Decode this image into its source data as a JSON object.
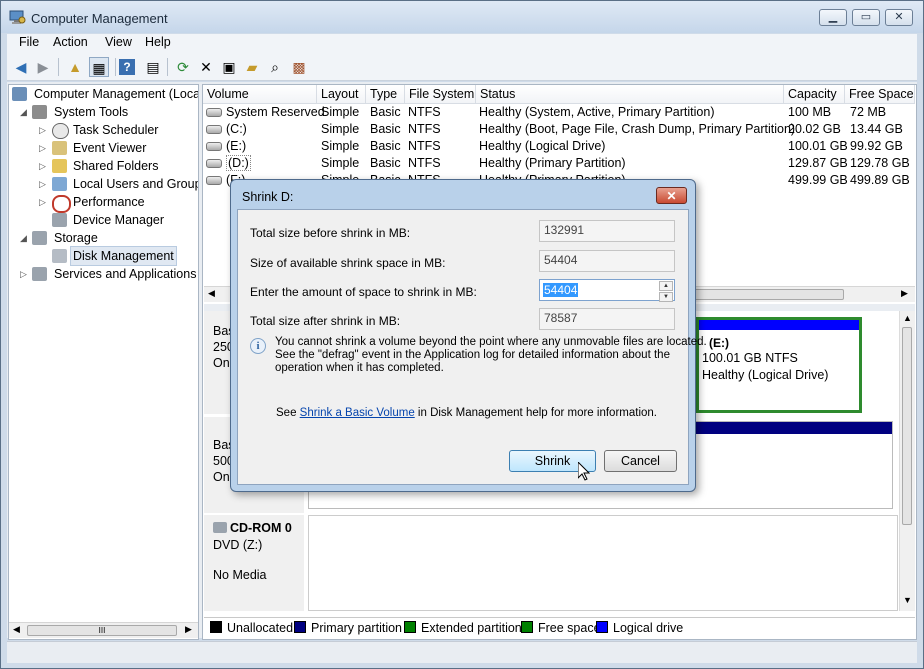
{
  "window": {
    "title": "Computer Management"
  },
  "menu": [
    "File",
    "Action",
    "View",
    "Help"
  ],
  "toolbar_icons": [
    "back-arrow-icon",
    "forward-arrow-icon",
    "up-folder-icon",
    "show-tree-icon",
    "help-icon",
    "properties-pane-icon",
    "refresh-icon",
    "delete-icon",
    "properties-icon",
    "open-icon",
    "search-icon",
    "disk-settings-icon"
  ],
  "tree": {
    "root": "Computer Management (Local",
    "system_tools": "System Tools",
    "task_scheduler": "Task Scheduler",
    "event_viewer": "Event Viewer",
    "shared_folders": "Shared Folders",
    "local_users": "Local Users and Groups",
    "performance": "Performance",
    "device_manager": "Device Manager",
    "storage": "Storage",
    "disk_management": "Disk Management",
    "services": "Services and Applications",
    "scroll_thumb": "III"
  },
  "volumes": {
    "headers": [
      "Volume",
      "Layout",
      "Type",
      "File System",
      "Status",
      "Capacity",
      "Free Space"
    ],
    "rows": [
      [
        "System Reserved",
        "Simple",
        "Basic",
        "NTFS",
        "Healthy (System, Active, Primary Partition)",
        "100 MB",
        "72 MB"
      ],
      [
        "(C:)",
        "Simple",
        "Basic",
        "NTFS",
        "Healthy (Boot, Page File, Crash Dump, Primary Partition)",
        "20.02 GB",
        "13.44 GB"
      ],
      [
        "(E:)",
        "Simple",
        "Basic",
        "NTFS",
        "Healthy (Logical Drive)",
        "100.01 GB",
        "99.92 GB"
      ],
      [
        "(D:)",
        "Simple",
        "Basic",
        "NTFS",
        "Healthy (Primary Partition)",
        "129.87 GB",
        "129.78 GB"
      ],
      [
        "(F:)",
        "Simple",
        "Basic",
        "NTFS",
        "Healthy (Primary Partition)",
        "499.99 GB",
        "499.89 GB"
      ]
    ]
  },
  "disks": {
    "disk0": {
      "l1": "Bas",
      "l2": "250",
      "l3": "On"
    },
    "disk1": {
      "l1": "Bas",
      "l2": "500",
      "l3": "On"
    },
    "cdrom": {
      "name": "CD-ROM 0",
      "type": "DVD (Z:)",
      "media": "No Media"
    },
    "e_part": {
      "name": "(E:)",
      "size": "100.01 GB NTFS",
      "status": "Healthy (Logical Drive)"
    }
  },
  "legend": [
    "Unallocated",
    "Primary partition",
    "Extended partition",
    "Free space",
    "Logical drive"
  ],
  "legend_colors": [
    "#000000",
    "#000080",
    "#008000",
    "#008000",
    "#0000ff"
  ],
  "dialog": {
    "title": "Shrink D:",
    "total_before_label": "Total size before shrink in MB:",
    "total_before_value": "132991",
    "available_label": "Size of available shrink space in MB:",
    "available_value": "54404",
    "amount_label": "Enter the amount of space to shrink in MB:",
    "amount_value": "54404",
    "total_after_label": "Total size after shrink in MB:",
    "total_after_value": "78587",
    "info_text_1": "You cannot shrink a volume beyond the point where any unmovable files are located.",
    "info_text_2": "See the \"defrag\" event in the Application log for detailed information about the",
    "info_text_3": "operation when it has completed.",
    "see_prefix": "See ",
    "see_link": "Shrink a Basic Volume",
    "see_suffix": " in Disk Management help for more information.",
    "shrink_button": "Shrink",
    "cancel_button": "Cancel"
  }
}
